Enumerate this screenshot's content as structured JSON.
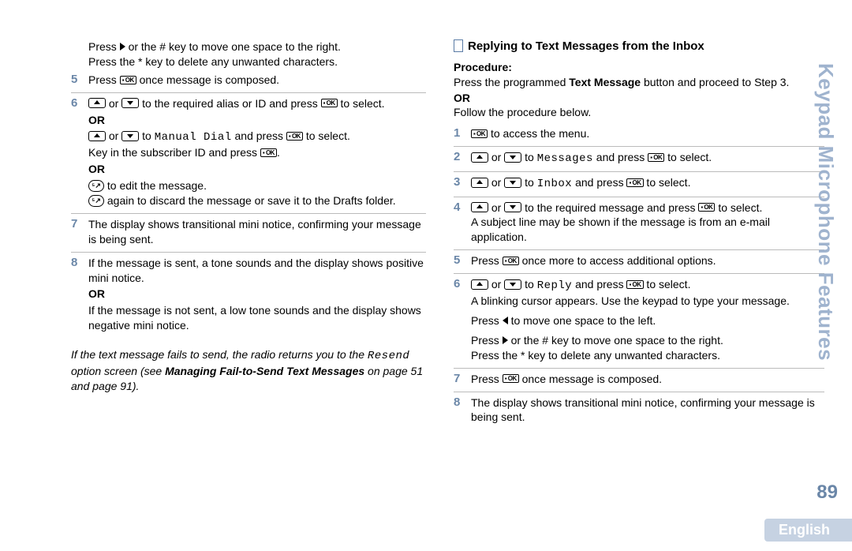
{
  "side_title": "Keypad Microphone Features",
  "page_number": "89",
  "language_tab": "English",
  "left": {
    "intro_line1_a": "Press ",
    "intro_line1_b": " or the # key to move one space to the right.",
    "intro_line2": "Press the * key to delete any unwanted characters.",
    "step5_a": "Press ",
    "step5_b": " once message is composed.",
    "step6_a1": " or ",
    "step6_a2": " to the required alias or ID and press ",
    "step6_a3": " to select.",
    "or": "OR",
    "step6_b1": " or ",
    "step6_b2": " to ",
    "step6_b_mono": "Manual Dial",
    "step6_b3": " and press ",
    "step6_b4": " to select.",
    "step6_c1": "Key in the subscriber ID and press ",
    "step6_c2": ".",
    "step6_d1": " to edit the message.",
    "step6_e1": " again to discard the message or save it to the Drafts folder.",
    "step7": "The display shows transitional mini notice, confirming your message is being sent.",
    "step8_a": "If the message is sent, a tone sounds and the display shows positive mini notice.",
    "step8_b": "If the message is not sent, a low tone sounds and the display shows negative mini notice.",
    "fail_note_a": "If the text message fails to send, the radio returns you to the ",
    "fail_note_mono": "Resend",
    "fail_note_b": " option screen (see ",
    "fail_note_bold": "Managing Fail-to-Send Text Messages",
    "fail_note_c": " on page 51 and page 91)."
  },
  "right": {
    "heading": "Replying to Text Messages from the Inbox",
    "procedure_label": "Procedure:",
    "proc_a": "Press the programmed ",
    "proc_bold": "Text Message",
    "proc_b": " button and proceed to Step 3.",
    "or": "OR",
    "proc_c": "Follow the procedure below.",
    "r1_a": " to access the menu.",
    "r2_a": " or ",
    "r2_b": " to ",
    "r2_mono": "Messages",
    "r2_c": " and press ",
    "r2_d": " to select.",
    "r3_a": " or ",
    "r3_b": " to ",
    "r3_mono": "Inbox",
    "r3_c": " and press ",
    "r3_d": " to select.",
    "r4_a": " or ",
    "r4_b": " to the required message and press ",
    "r4_c": " to select.",
    "r4_line2": "A subject line may be shown if the message is from an e-mail application.",
    "r5_a": "Press ",
    "r5_b": " once more to access additional options.",
    "r6_a": " or ",
    "r6_b": " to ",
    "r6_mono": "Reply",
    "r6_c": " and press ",
    "r6_d": " to select.",
    "r6_line2": "A blinking cursor appears. Use the keypad to type your message.",
    "r6_left_a": "Press ",
    "r6_left_b": " to move one space to the left.",
    "r6_right_a": "Press ",
    "r6_right_b": " or the # key to move one space to the right.",
    "r6_star": "Press the * key to delete any unwanted characters.",
    "r7_a": "Press ",
    "r7_b": " once message is composed.",
    "r8": "The display shows transitional mini notice, confirming your message is being sent."
  }
}
